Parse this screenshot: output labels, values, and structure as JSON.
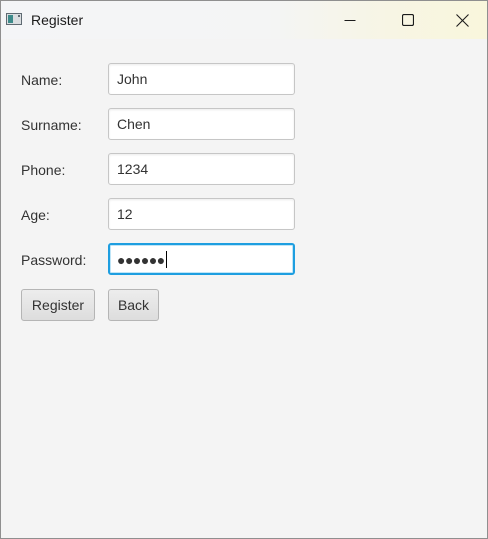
{
  "window": {
    "title": "Register",
    "controls": {
      "minimize": "minimize-icon",
      "maximize": "maximize-icon",
      "close": "close-icon"
    }
  },
  "form": {
    "name": {
      "label": "Name:",
      "value": "John"
    },
    "surname": {
      "label": "Surname:",
      "value": "Chen"
    },
    "phone": {
      "label": "Phone:",
      "value": "1234"
    },
    "age": {
      "label": "Age:",
      "value": "12"
    },
    "password": {
      "label": "Password:",
      "value": "●●●●●●"
    }
  },
  "buttons": {
    "register": "Register",
    "back": "Back"
  },
  "colors": {
    "focus_border": "#1e9ee0",
    "window_background": "#f4f4f4"
  }
}
